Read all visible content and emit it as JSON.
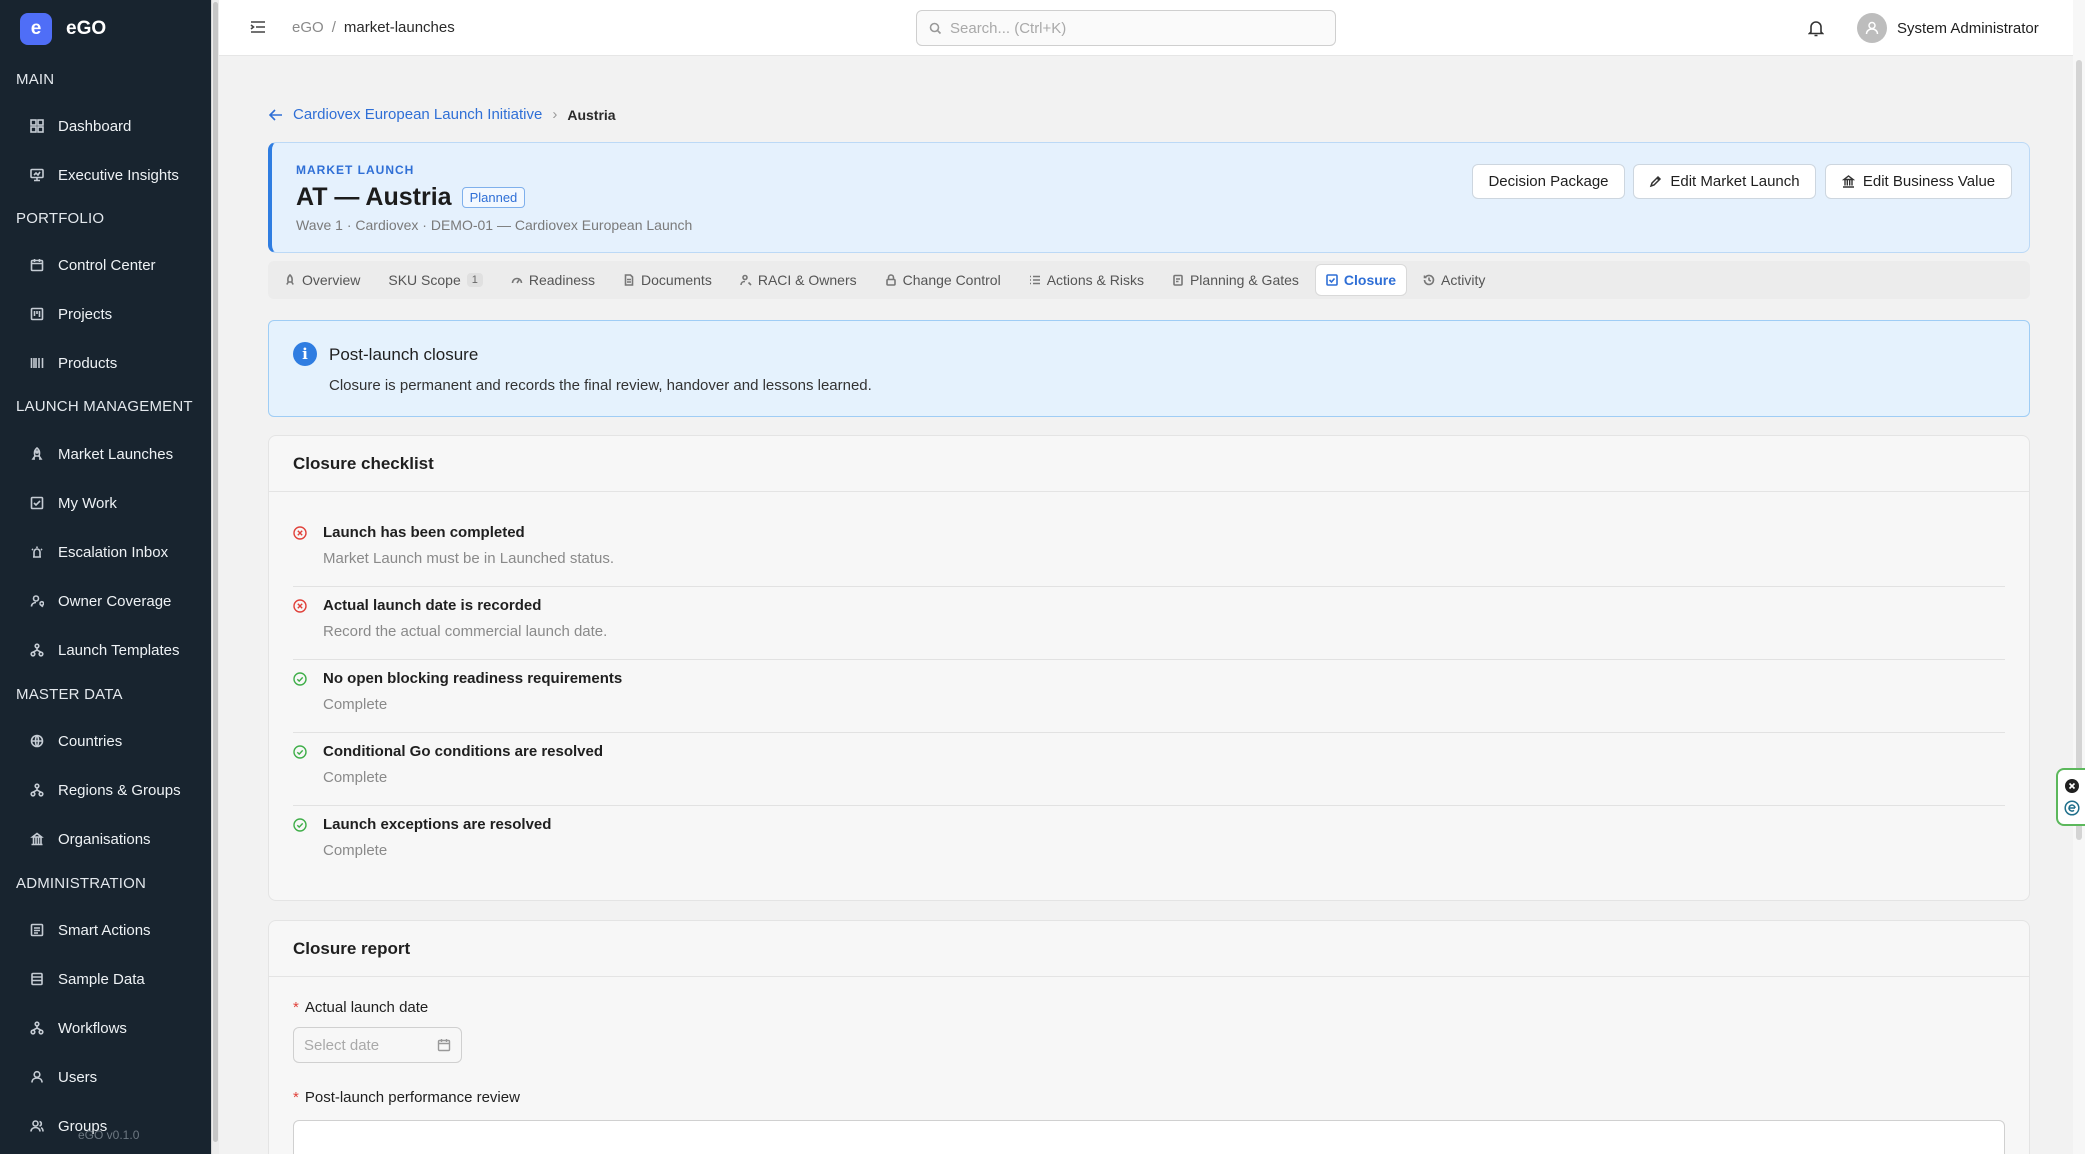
{
  "app": {
    "logo_letter": "e",
    "name": "eGO",
    "version": "eGO v0.1.0"
  },
  "sidebar": {
    "sections": [
      {
        "label": "MAIN",
        "items": [
          {
            "label": "Dashboard",
            "icon": "grid-icon"
          },
          {
            "label": "Executive Insights",
            "icon": "presentation-icon"
          }
        ]
      },
      {
        "label": "PORTFOLIO",
        "items": [
          {
            "label": "Control Center",
            "icon": "calendar-icon"
          },
          {
            "label": "Projects",
            "icon": "board-icon"
          },
          {
            "label": "Products",
            "icon": "barcode-icon"
          }
        ]
      },
      {
        "label": "LAUNCH MANAGEMENT",
        "items": [
          {
            "label": "Market Launches",
            "icon": "rocket-icon"
          },
          {
            "label": "My Work",
            "icon": "checkbox-icon"
          },
          {
            "label": "Escalation Inbox",
            "icon": "alarm-icon"
          },
          {
            "label": "Owner Coverage",
            "icon": "user-search-icon"
          },
          {
            "label": "Launch Templates",
            "icon": "hierarchy-icon"
          }
        ]
      },
      {
        "label": "MASTER DATA",
        "items": [
          {
            "label": "Countries",
            "icon": "globe-icon"
          },
          {
            "label": "Regions & Groups",
            "icon": "hierarchy-icon"
          },
          {
            "label": "Organisations",
            "icon": "building-icon"
          }
        ]
      },
      {
        "label": "ADMINISTRATION",
        "items": [
          {
            "label": "Smart Actions",
            "icon": "sparkle-icon"
          },
          {
            "label": "Sample Data",
            "icon": "database-icon"
          },
          {
            "label": "Workflows",
            "icon": "hierarchy-icon"
          },
          {
            "label": "Users",
            "icon": "user-icon"
          },
          {
            "label": "Groups",
            "icon": "users-icon"
          }
        ]
      }
    ]
  },
  "topbar": {
    "breadcrumb": [
      "eGO",
      "/",
      "market-launches"
    ],
    "search_placeholder": "Search... (Ctrl+K)",
    "user_name": "System Administrator"
  },
  "page": {
    "breadcrumb_parent": "Cardiovex European Launch Initiative",
    "breadcrumb_separator": "›",
    "breadcrumb_current": "Austria",
    "kicker": "MARKET LAUNCH",
    "title": "AT — Austria",
    "status": "Planned",
    "subtitle": "Wave 1 · Cardiovex · DEMO-01 — Cardiovex European Launch",
    "actions": {
      "decision": "Decision Package",
      "edit_launch": "Edit Market Launch",
      "edit_value": "Edit Business Value"
    }
  },
  "tabs": [
    {
      "label": "Overview",
      "icon": "rocket-icon"
    },
    {
      "label": "SKU Scope",
      "icon": "",
      "count": "1"
    },
    {
      "label": "Readiness",
      "icon": "gauge-icon"
    },
    {
      "label": "Documents",
      "icon": "document-icon"
    },
    {
      "label": "RACI & Owners",
      "icon": "user-search-icon"
    },
    {
      "label": "Change Control",
      "icon": "lock-icon"
    },
    {
      "label": "Actions & Risks",
      "icon": "list-icon"
    },
    {
      "label": "Planning & Gates",
      "icon": "clipboard-icon"
    },
    {
      "label": "Closure",
      "icon": "checkbox-icon",
      "active": true
    },
    {
      "label": "Activity",
      "icon": "history-icon"
    }
  ],
  "alert": {
    "title": "Post-launch closure",
    "text": "Closure is permanent and records the final review, handover and lessons learned."
  },
  "checklist": {
    "title": "Closure checklist",
    "items": [
      {
        "label": "Launch has been completed",
        "desc": "Market Launch must be in Launched status.",
        "status": "fail"
      },
      {
        "label": "Actual launch date is recorded",
        "desc": "Record the actual commercial launch date.",
        "status": "fail"
      },
      {
        "label": "No open blocking readiness requirements",
        "desc": "Complete",
        "status": "pass"
      },
      {
        "label": "Conditional Go conditions are resolved",
        "desc": "Complete",
        "status": "pass"
      },
      {
        "label": "Launch exceptions are resolved",
        "desc": "Complete",
        "status": "pass"
      }
    ]
  },
  "report": {
    "title": "Closure report",
    "date_label": "Actual launch date",
    "date_placeholder": "Select date",
    "review_label": "Post-launch performance review",
    "required_mark": "*"
  },
  "colors": {
    "accent": "#2f6fd6",
    "sidebar_bg": "#18242f",
    "fail": "#e0413a",
    "pass": "#3fae49"
  }
}
